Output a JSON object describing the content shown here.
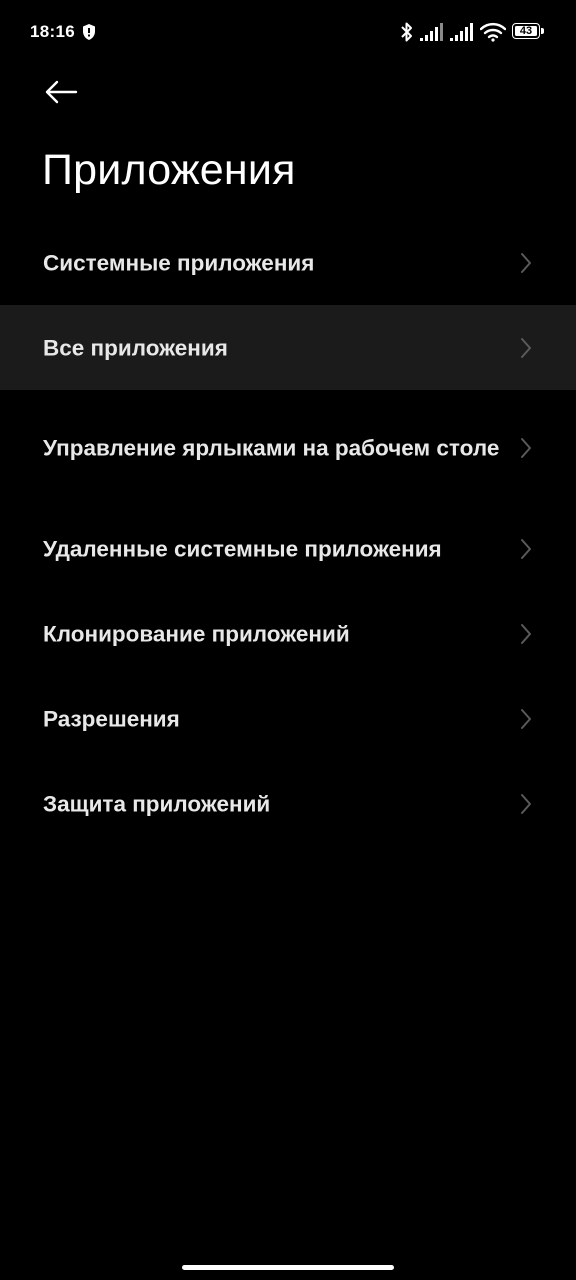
{
  "status_bar": {
    "time": "18:16",
    "battery_level": "43",
    "icons": [
      "shield-icon",
      "bluetooth-icon",
      "signal-icon",
      "signal-icon",
      "wifi-icon",
      "battery-icon"
    ]
  },
  "header": {
    "back_icon": "arrow-left-icon",
    "title": "Приложения"
  },
  "menu": {
    "items": [
      {
        "label": "Системные приложения",
        "highlighted": false
      },
      {
        "label": "Все приложения",
        "highlighted": true
      },
      {
        "label": "Управление ярлыками на рабочем столе",
        "highlighted": false
      },
      {
        "label": "Удаленные системные приложения",
        "highlighted": false
      },
      {
        "label": "Клонирование приложений",
        "highlighted": false
      },
      {
        "label": "Разрешения",
        "highlighted": false
      },
      {
        "label": "Защита приложений",
        "highlighted": false
      }
    ]
  },
  "colors": {
    "background": "#000000",
    "text": "#e8e8e8",
    "highlight_row": "#1b1b1b",
    "chevron": "#5a5a5a"
  }
}
